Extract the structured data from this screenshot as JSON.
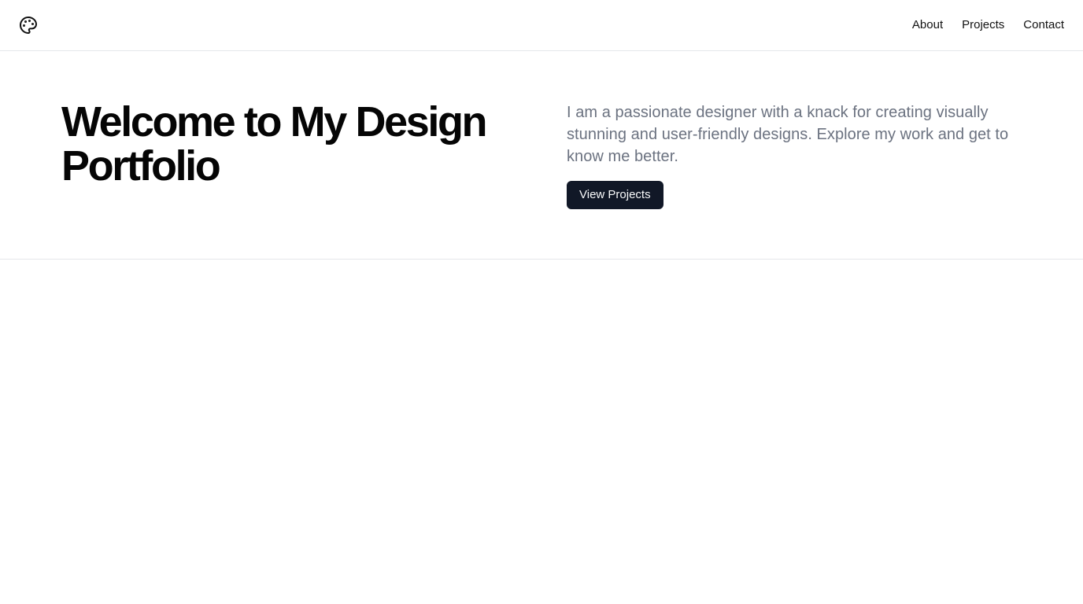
{
  "header": {
    "logo_icon": "palette-icon",
    "nav": [
      {
        "label": "About"
      },
      {
        "label": "Projects"
      },
      {
        "label": "Contact"
      }
    ]
  },
  "hero": {
    "title": "Welcome to My Design Portfolio",
    "description": "I am a passionate designer with a knack for creating visually stunning and user-friendly designs. Explore my work and get to know me better.",
    "cta_label": "View Projects"
  },
  "colors": {
    "button_bg": "#111827",
    "description_text": "#6b7280",
    "border": "#e5e7eb"
  }
}
